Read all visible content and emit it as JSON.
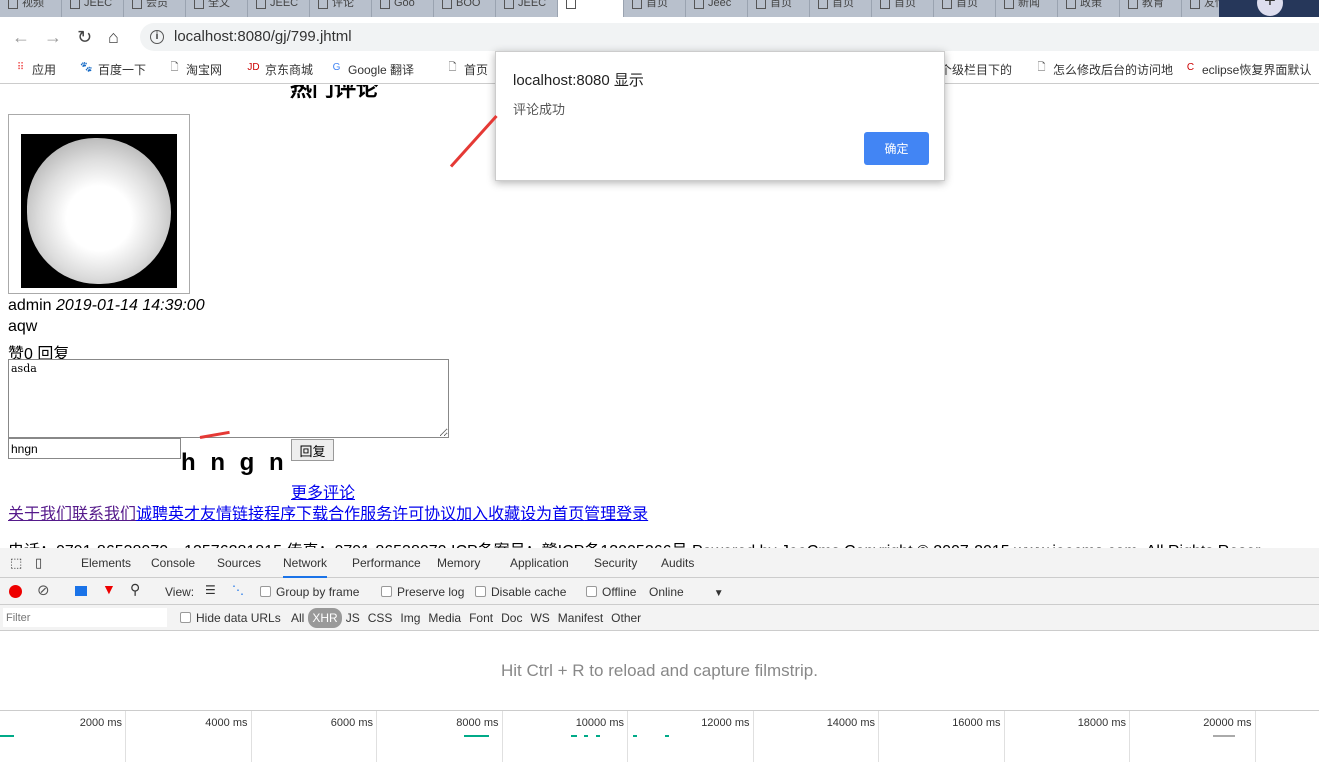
{
  "browser": {
    "tabs": [
      "视频",
      "JEEC",
      "会员",
      "全文",
      "JEEC",
      "评论",
      "Goo",
      "BOO",
      "JEEC",
      "",
      "首页",
      "Jeec",
      "首页",
      "首页",
      "首页",
      "首页",
      "新闻",
      "政策",
      "教育",
      "友情"
    ],
    "active_tab": 9,
    "url": "localhost:8080/gj/799.jhtml",
    "bookmarks": [
      "应用",
      "百度一下",
      "淘宝网",
      "京东商城",
      "Google 翻译",
      "首页",
      "一个级栏目下的",
      "怎么修改后台的访问地",
      "eclipse恢复界面默认"
    ]
  },
  "page": {
    "heading": "热门评论",
    "comment": {
      "user": "admin",
      "time": "2019-01-14 14:39:00",
      "text": "aqw",
      "like_label": "赞0",
      "reply_label": "回复"
    },
    "reply_textarea_value": "asda",
    "captcha_input_value": "hngn",
    "captcha_image_text": "h n g n",
    "reply_button": "回复",
    "more_comments": "更多评论",
    "footer_links": [
      "关于我们",
      "联系我们",
      "诚聘英才",
      "友情链接",
      "程序下载",
      "合作服务",
      "许可协议",
      "加入收藏",
      "设为首页",
      "管理登录"
    ],
    "footer_text": "电话：0791-86538070，13576281815 传真：0791-86538070 ICP备案号：赣ICP备13005266号 Powered by JeeCms Copyright © 2007-2015 www.jeecms.com. All Rights Reser"
  },
  "dialog": {
    "title": "localhost:8080 显示",
    "message": "评论成功",
    "ok": "确定",
    "button_color": "#4285f4"
  },
  "devtools": {
    "tabs": [
      "Elements",
      "Console",
      "Sources",
      "Network",
      "Performance",
      "Memory",
      "Application",
      "Security",
      "Audits"
    ],
    "active": "Network",
    "view_label": "View:",
    "group_by_frame": "Group by frame",
    "preserve_log": "Preserve log",
    "disable_cache": "Disable cache",
    "offline": "Offline",
    "throttle": "Online",
    "filter_placeholder": "Filter",
    "hide_data_urls": "Hide data URLs",
    "types": [
      "All",
      "XHR",
      "JS",
      "CSS",
      "Img",
      "Media",
      "Font",
      "Doc",
      "WS",
      "Manifest",
      "Other"
    ],
    "active_type": "XHR",
    "filmstrip_hint": "Hit Ctrl + R to reload and capture filmstrip.",
    "timeline_ticks": [
      "2000 ms",
      "4000 ms",
      "6000 ms",
      "8000 ms",
      "10000 ms",
      "12000 ms",
      "14000 ms",
      "16000 ms",
      "18000 ms",
      "20000 ms"
    ]
  }
}
